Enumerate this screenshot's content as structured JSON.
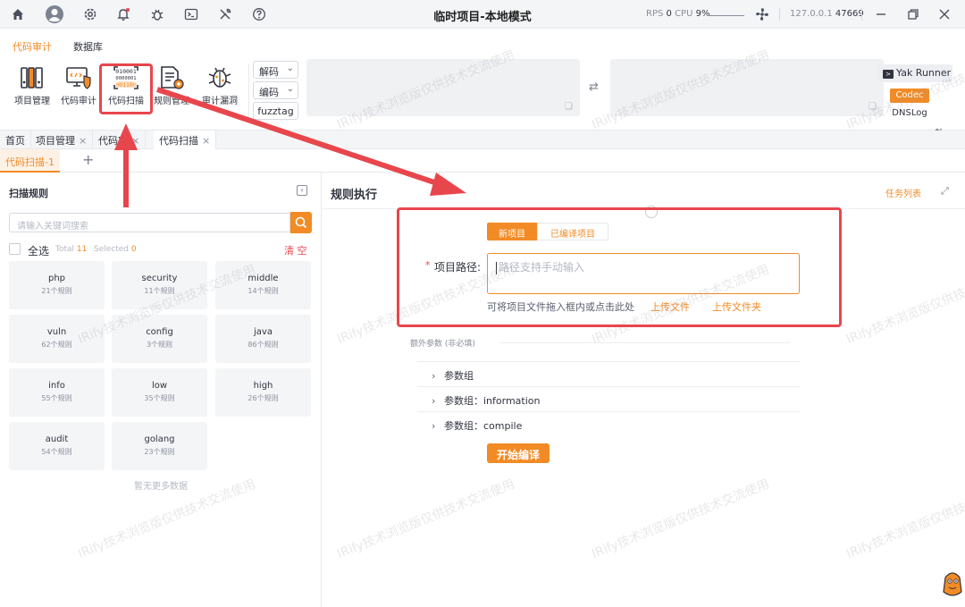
{
  "window": {
    "title": "临时项目-本地模式",
    "rps_label": "RPS",
    "rps_value": "0",
    "cpu_label": "CPU",
    "cpu_value": "9%",
    "host": "127.0.0.1",
    "port": "47669"
  },
  "ribbon": {
    "tabs": [
      "代码审计",
      "数据库"
    ],
    "tools": [
      "项目管理",
      "代码审计",
      "代码扫描",
      "规则管理",
      "审计漏洞"
    ],
    "decode_label": "解码",
    "encode_label": "编码",
    "fuzztag_label": "fuzztag",
    "yak_runner_label": "Yak Runner",
    "codec_label": "Codec",
    "dnslog_label": "DNSLog",
    "scan_icon_text": [
      "010001",
      "0000001",
      "001100"
    ]
  },
  "page_tabs": [
    {
      "label": "首页",
      "closable": false
    },
    {
      "label": "项目管理",
      "closable": true
    },
    {
      "label": "代码审",
      "closable": true
    },
    {
      "label": "代码扫描",
      "closable": true
    }
  ],
  "subtab": {
    "label": "代码扫描-1",
    "add_label": "+"
  },
  "left": {
    "title": "扫描规则",
    "search_placeholder": "请输入关键词搜索",
    "select_all_label": "全选",
    "total_label": "Total",
    "total_value": "11",
    "selected_label": "Selected",
    "selected_value": "0",
    "clear_label": "清 空",
    "groups": [
      {
        "name": "php",
        "count": "21个规则"
      },
      {
        "name": "security",
        "count": "11个规则"
      },
      {
        "name": "middle",
        "count": "14个规则"
      },
      {
        "name": "vuln",
        "count": "62个规则"
      },
      {
        "name": "config",
        "count": "3个规则"
      },
      {
        "name": "java",
        "count": "86个规则"
      },
      {
        "name": "info",
        "count": "55个规则"
      },
      {
        "name": "low",
        "count": "35个规则"
      },
      {
        "name": "high",
        "count": "26个规则"
      },
      {
        "name": "audit",
        "count": "54个规则"
      },
      {
        "name": "golang",
        "count": "23个规则"
      }
    ],
    "no_more_label": "暂无更多数据"
  },
  "right": {
    "title": "规则执行",
    "task_list_label": "任务列表",
    "mode_new_label": "新项目",
    "mode_compiled_label": "已编译项目",
    "path_required_mark": "*",
    "path_label": "项目路径:",
    "path_placeholder": "路径支持手动输入",
    "drop_hint": "可将项目文件拖入框内或点击此处",
    "upload_file_label": "上传文件",
    "upload_folder_label": "上传文件夹",
    "extra_params_label": "额外参数 (非必填)",
    "param_groups": [
      "参数组",
      "参数组：information",
      "参数组：compile"
    ],
    "start_compile_label": "开始编译"
  },
  "watermark": "IRify技术浏览版仅供技术交流使用",
  "colors": {
    "accent": "#f28b25",
    "annotation": "#e8464d",
    "danger": "#e8464d"
  }
}
